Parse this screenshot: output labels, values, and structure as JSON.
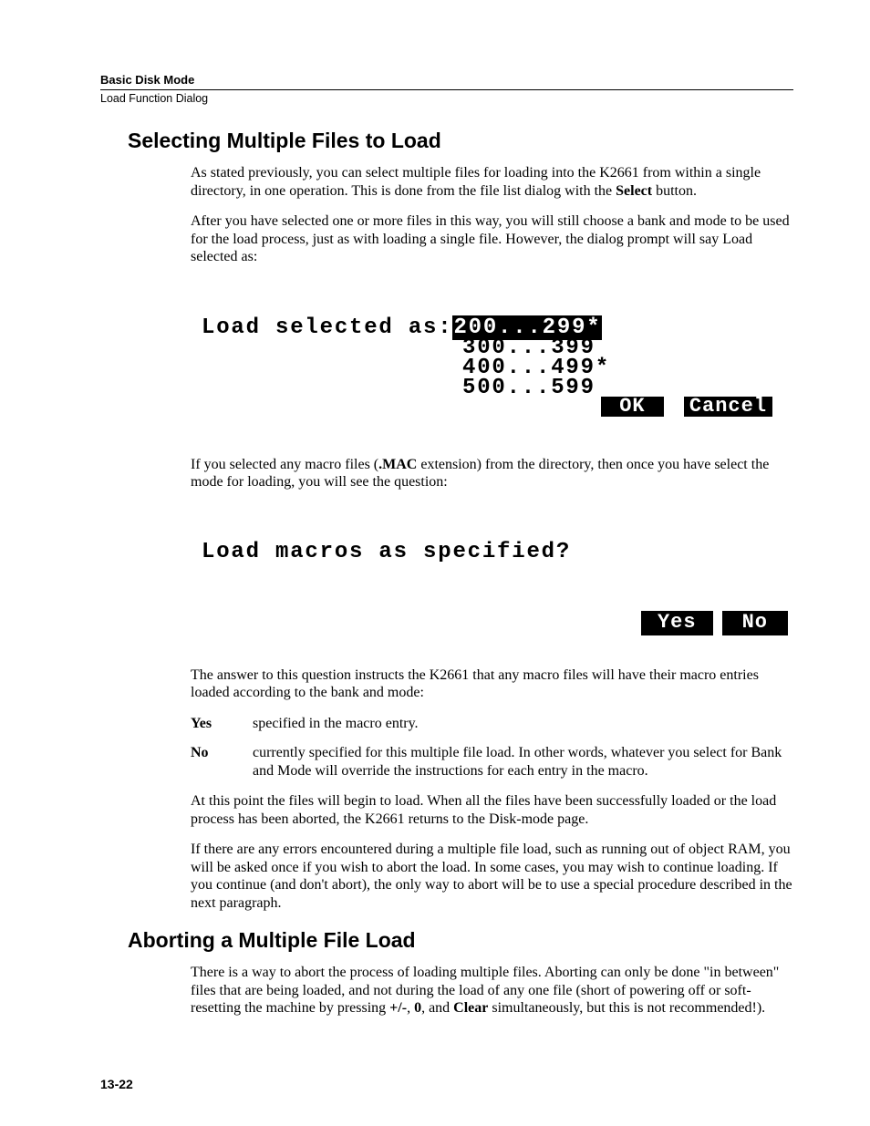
{
  "header": {
    "chapter": "Basic Disk Mode",
    "section": "Load Function Dialog"
  },
  "h2_1": "Selecting Multiple Files to Load",
  "p1a": "As stated previously, you can select multiple files for loading into the K2661 from within a single directory, in one operation. This is done from the file list dialog with the ",
  "p1b_bold": "Select",
  "p1c": " button.",
  "p2": "After you have selected one or more files in this way, you will still choose a bank and mode to be used for the load process, just as with loading a single file. However, the dialog prompt will say Load selected as:",
  "lcd1": {
    "prompt": "Load selected as:",
    "opt_sel": "200...299*",
    "opt2": "300...399",
    "opt3": "400...499*",
    "opt4": "500...599",
    "ok": "OK",
    "cancel": "Cancel"
  },
  "p3a": "If you selected any macro files (",
  "p3b_bold": ".MAC",
  "p3c": " extension) from the directory, then once you have select the mode for loading, you will see the question:",
  "lcd2": {
    "prompt": "Load macros as specified?",
    "yes": "Yes",
    "no": "No"
  },
  "p4": "The answer to this question instructs the K2661 that any macro files will have their macro entries loaded according to the bank and mode:",
  "def_yes_term": "Yes",
  "def_yes_def": "specified in the macro entry.",
  "def_no_term": "No",
  "def_no_def": "currently specified for this multiple file load. In other words, whatever you select for Bank and Mode will override the instructions for each entry in the macro.",
  "p5": "At this point the files will begin to load. When all the files have been successfully loaded or the load process has been aborted, the K2661 returns to the Disk-mode page.",
  "p6": "If there are any errors encountered during a multiple file load, such as running out of object RAM, you will be asked once if you wish to abort the load. In some cases, you may wish to continue loading. If you continue (and don't abort), the only way to abort will be to use a special procedure described in the next paragraph.",
  "h2_2": "Aborting a Multiple File Load",
  "p7a": "There is a way to abort the process of loading multiple files. Aborting can only be done \"in between\" files that are being loaded, and not during the load of any one file (short of powering off or soft-resetting the machine by pressing ",
  "p7b_bold": "+/-",
  "p7c": ", ",
  "p7d_bold": "0",
  "p7e": ", and ",
  "p7f_bold": "Clear",
  "p7g": " simultaneously, but this is not recommended!).",
  "pageno": "13-22"
}
